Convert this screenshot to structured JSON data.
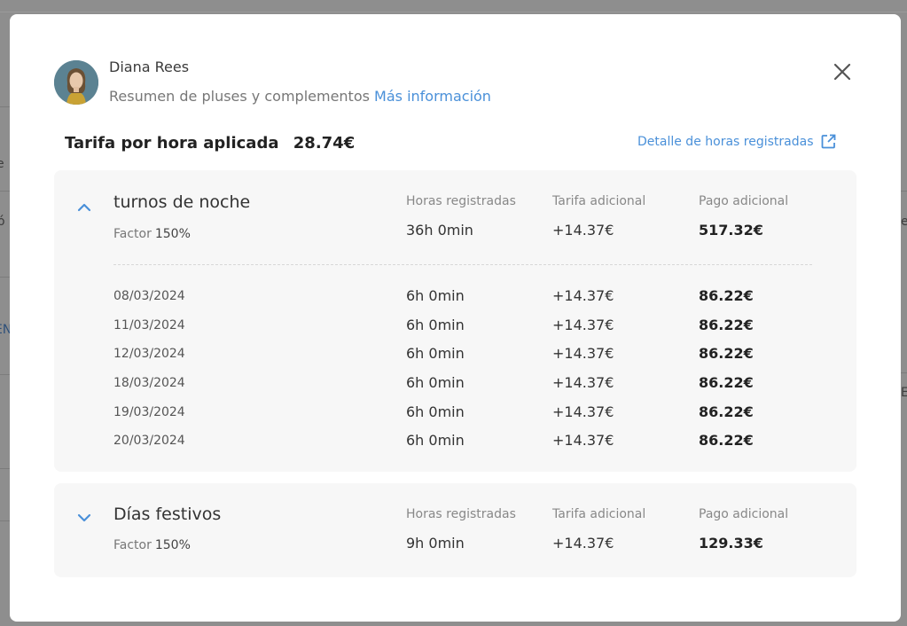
{
  "background": {
    "fragments": [
      "e",
      "ó",
      "EN",
      "e",
      "E"
    ]
  },
  "modal": {
    "user_name": "Diana Rees",
    "subtitle": "Resumen de pluses y complementos",
    "more_info_link": "Más información",
    "rate_label": "Tarifa por hora aplicada",
    "rate_value": "28.74€",
    "detail_link": "Detalle de horas registradas",
    "colors": {
      "accent": "#4a90d9",
      "panel_bg": "#f7f7f7"
    }
  },
  "columns": {
    "hours": "Horas registradas",
    "rate": "Tarifa adicional",
    "payment": "Pago adicional"
  },
  "sections": [
    {
      "title": "turnos de noche",
      "factor_label": "Factor",
      "factor_value": "150%",
      "hours": "36h 0min",
      "rate": "+14.37€",
      "payment": "517.32€",
      "expanded": true,
      "rows": [
        {
          "date": "08/03/2024",
          "hours": "6h 0min",
          "rate": "+14.37€",
          "payment": "86.22€"
        },
        {
          "date": "11/03/2024",
          "hours": "6h 0min",
          "rate": "+14.37€",
          "payment": "86.22€"
        },
        {
          "date": "12/03/2024",
          "hours": "6h 0min",
          "rate": "+14.37€",
          "payment": "86.22€"
        },
        {
          "date": "18/03/2024",
          "hours": "6h 0min",
          "rate": "+14.37€",
          "payment": "86.22€"
        },
        {
          "date": "19/03/2024",
          "hours": "6h 0min",
          "rate": "+14.37€",
          "payment": "86.22€"
        },
        {
          "date": "20/03/2024",
          "hours": "6h 0min",
          "rate": "+14.37€",
          "payment": "86.22€"
        }
      ]
    },
    {
      "title": "Días festivos",
      "factor_label": "Factor",
      "factor_value": "150%",
      "hours": "9h 0min",
      "rate": "+14.37€",
      "payment": "129.33€",
      "expanded": false
    }
  ]
}
